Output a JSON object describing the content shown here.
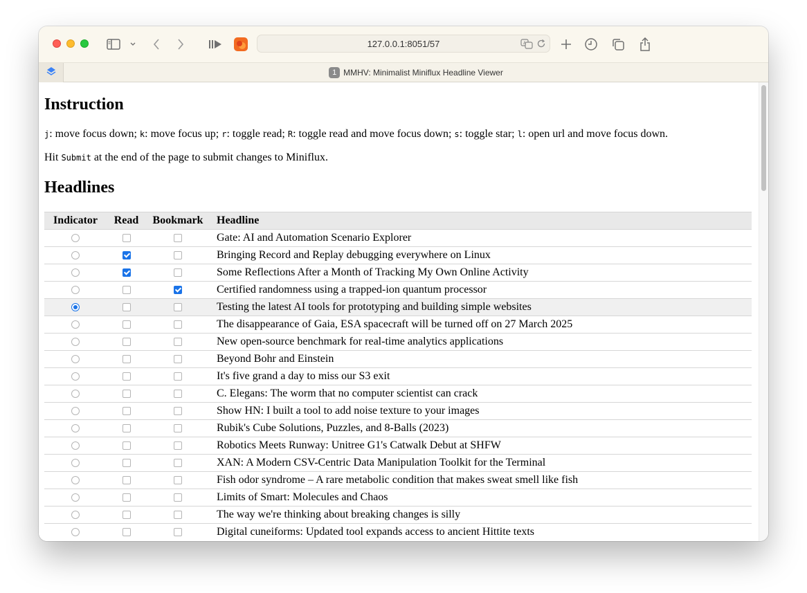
{
  "browser": {
    "url": "127.0.0.1:8051/57",
    "tab_badge": "1",
    "tab_title": "MMHV: Minimalist Miniflux Headline Viewer"
  },
  "page": {
    "instruction_heading": "Instruction",
    "keys": {
      "j_key": "j",
      "j_desc": ": move focus down; ",
      "k_key": "k",
      "k_desc": ": move focus up; ",
      "r_key": "r",
      "r_desc": ": toggle read; ",
      "R_key": "R",
      "R_desc": ": toggle read and move focus down; ",
      "s_key": "s",
      "s_desc": ": toggle star; ",
      "l_key": "l",
      "l_desc": ": open url and move focus down."
    },
    "submit_hint": {
      "prefix": "Hit ",
      "code": "Submit",
      "suffix": " at the end of the page to submit changes to Miniflux."
    },
    "headlines_heading": "Headlines",
    "columns": {
      "indicator": "Indicator",
      "read": "Read",
      "bookmark": "Bookmark",
      "headline": "Headline"
    },
    "rows": [
      {
        "headline": "Gate: AI and Automation Scenario Explorer",
        "indicator": false,
        "read": false,
        "bookmark": false
      },
      {
        "headline": "Bringing Record and Replay debugging everywhere on Linux",
        "indicator": false,
        "read": true,
        "bookmark": false
      },
      {
        "headline": "Some Reflections After a Month of Tracking My Own Online Activity",
        "indicator": false,
        "read": true,
        "bookmark": false
      },
      {
        "headline": "Certified randomness using a trapped-ion quantum processor",
        "indicator": false,
        "read": false,
        "bookmark": true
      },
      {
        "headline": "Testing the latest AI tools for prototyping and building simple websites",
        "indicator": true,
        "read": false,
        "bookmark": false
      },
      {
        "headline": "The disappearance of Gaia, ESA spacecraft will be turned off on 27 March 2025",
        "indicator": false,
        "read": false,
        "bookmark": false
      },
      {
        "headline": "New open-source benchmark for real-time analytics applications",
        "indicator": false,
        "read": false,
        "bookmark": false
      },
      {
        "headline": "Beyond Bohr and Einstein",
        "indicator": false,
        "read": false,
        "bookmark": false
      },
      {
        "headline": "It's five grand a day to miss our S3 exit",
        "indicator": false,
        "read": false,
        "bookmark": false
      },
      {
        "headline": "C. Elegans: The worm that no computer scientist can crack",
        "indicator": false,
        "read": false,
        "bookmark": false
      },
      {
        "headline": "Show HN: I built a tool to add noise texture to your images",
        "indicator": false,
        "read": false,
        "bookmark": false
      },
      {
        "headline": "Rubik's Cube Solutions, Puzzles, and 8-Balls (2023)",
        "indicator": false,
        "read": false,
        "bookmark": false
      },
      {
        "headline": "Robotics Meets Runway: Unitree G1's Catwalk Debut at SHFW",
        "indicator": false,
        "read": false,
        "bookmark": false
      },
      {
        "headline": "XAN: A Modern CSV-Centric Data Manipulation Toolkit for the Terminal",
        "indicator": false,
        "read": false,
        "bookmark": false
      },
      {
        "headline": "Fish odor syndrome – A rare metabolic condition that makes sweat smell like fish",
        "indicator": false,
        "read": false,
        "bookmark": false
      },
      {
        "headline": "Limits of Smart: Molecules and Chaos",
        "indicator": false,
        "read": false,
        "bookmark": false
      },
      {
        "headline": "The way we're thinking about breaking changes is silly",
        "indicator": false,
        "read": false,
        "bookmark": false
      },
      {
        "headline": "Digital cuneiforms: Updated tool expands access to ancient Hittite texts",
        "indicator": false,
        "read": false,
        "bookmark": false
      }
    ]
  },
  "colors": {
    "accent": "#1a73e8",
    "titlebar": "#faf7ee",
    "header_row": "#e9e9e9"
  }
}
